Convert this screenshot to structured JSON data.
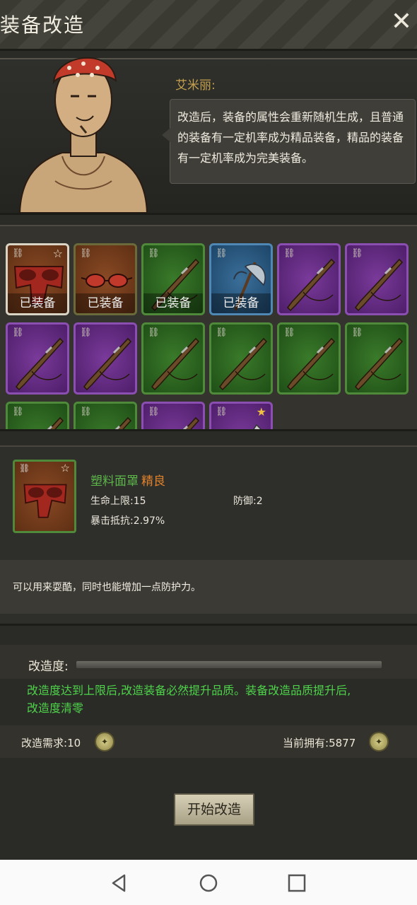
{
  "window": {
    "title": "装备改造",
    "close_glyph": "✕"
  },
  "npc": {
    "name": "艾米丽:",
    "dialog": "改造后，装备的属性会重新随机生成，且普通的装备有一定机率成为精品装备，精品的装备有一定机率成为完美装备。"
  },
  "inventory": {
    "slots": [
      {
        "rarity": "orange",
        "icon": "mask-icon",
        "equipped_label": "已装备",
        "star": "hollow",
        "selected": true
      },
      {
        "rarity": "orange",
        "icon": "goggles-icon",
        "equipped_label": "已装备"
      },
      {
        "rarity": "green",
        "icon": "rifle-icon",
        "equipped_label": "已装备"
      },
      {
        "rarity": "blue",
        "icon": "axe-icon",
        "equipped_label": "已装备"
      },
      {
        "rarity": "purple",
        "icon": "rifle-icon"
      },
      {
        "rarity": "purple",
        "icon": "rifle-icon"
      },
      {
        "rarity": "purple",
        "icon": "rifle-icon"
      },
      {
        "rarity": "purple",
        "icon": "rifle-icon"
      },
      {
        "rarity": "green",
        "icon": "rifle-icon"
      },
      {
        "rarity": "green",
        "icon": "rifle-icon"
      },
      {
        "rarity": "green",
        "icon": "rifle-icon"
      },
      {
        "rarity": "green",
        "icon": "rifle-icon"
      },
      {
        "rarity": "green",
        "icon": "rifle-icon"
      },
      {
        "rarity": "green",
        "icon": "rifle-icon"
      },
      {
        "rarity": "purple",
        "icon": "rifle-icon"
      },
      {
        "rarity": "purple",
        "icon": "knife-icon",
        "star": "gold"
      }
    ]
  },
  "item": {
    "name": "塑料面罩",
    "quality": "精良",
    "hp_label": "生命上限:",
    "hp_value": "15",
    "def_label": "防御:",
    "def_value": "2",
    "crit_label": "暴击抵抗:",
    "crit_value": "2.97%",
    "description": "可以用来耍酷，同时也能增加一点防护力。"
  },
  "modify": {
    "degree_label": "改造度:",
    "degree_progress": 0,
    "note": "改造度达到上限后,改造装备必然提升品质。装备改造品质提升后,改造度清零",
    "requirement_label": "改造需求:",
    "requirement_value": "10",
    "owned_label": "当前拥有:",
    "owned_value": "5877",
    "start_button": "开始改造"
  },
  "colors": {
    "quality_orange": "#e0822c",
    "name_green": "#5cb64a",
    "note_green": "#4ed44a"
  }
}
